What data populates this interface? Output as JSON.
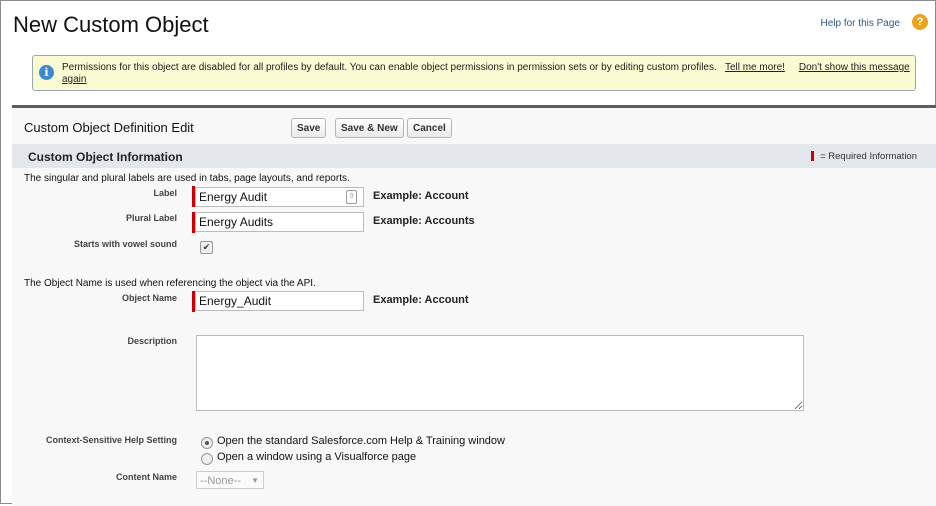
{
  "page": {
    "title": "New Custom Object",
    "help_link": "Help for this Page",
    "help_icon": "question-circle-icon"
  },
  "banner": {
    "icon": "info-icon",
    "message": "Permissions for this object are disabled for all profiles by default. You can enable object permissions in permission sets or by editing custom profiles.",
    "tell_me_more": "Tell me more!",
    "dont_show": "Don't show this message again"
  },
  "edit": {
    "title": "Custom Object Definition Edit",
    "buttons": {
      "save": "Save",
      "save_new": "Save & New",
      "cancel": "Cancel"
    }
  },
  "section": {
    "title": "Custom Object Information",
    "required_legend": "= Required Information",
    "required_color": "#cc0000"
  },
  "form": {
    "labels_note": "The singular and plural labels are used in tabs, page layouts, and reports.",
    "label": {
      "label": "Label",
      "value": "Energy Audit",
      "example": "Example:  Account"
    },
    "plural": {
      "label": "Plural Label",
      "value": "Energy Audits",
      "example": "Example:  Accounts"
    },
    "vowel": {
      "label": "Starts with vowel sound",
      "checked": true
    },
    "api_note": "The Object Name is used when referencing the object via the API.",
    "object_name": {
      "label": "Object Name",
      "value": "Energy_Audit",
      "example": "Example:  Account"
    },
    "description": {
      "label": "Description",
      "value": ""
    },
    "help_setting": {
      "label": "Context-Sensitive Help Setting",
      "options": [
        "Open the standard Salesforce.com Help & Training window",
        "Open a window using a Visualforce page"
      ],
      "selected": 0
    },
    "content_name": {
      "label": "Content Name",
      "value": "--None--"
    }
  }
}
